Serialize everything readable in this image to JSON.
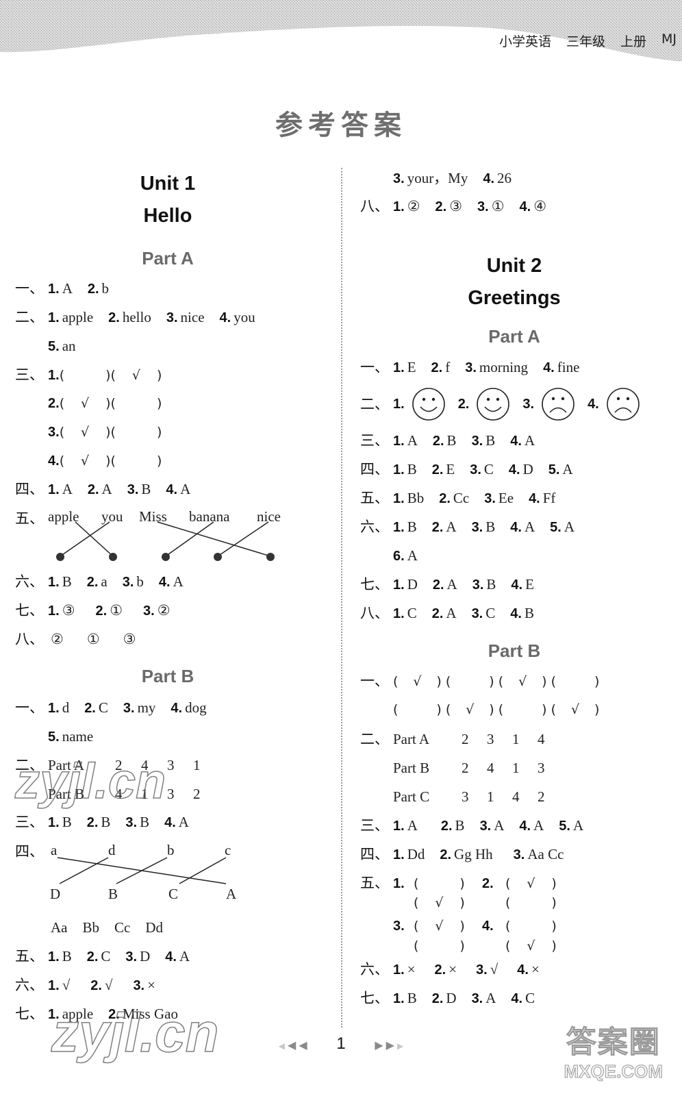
{
  "header": {
    "subject": "小学英语",
    "grade": "三年级",
    "volume": "上册",
    "edition": "MJ"
  },
  "page_title": "参考答案",
  "units": [
    {
      "unit": "Unit 1",
      "name": "Hello",
      "parts": [
        {
          "title": "Part A",
          "questions": {
            "q1": {
              "label": "一、",
              "items": [
                {
                  "n": "1.",
                  "a": "A"
                },
                {
                  "n": "2.",
                  "a": "b"
                }
              ]
            },
            "q2": {
              "label": "二、",
              "items": [
                {
                  "n": "1.",
                  "a": "apple"
                },
                {
                  "n": "2.",
                  "a": "hello"
                },
                {
                  "n": "3.",
                  "a": "nice"
                },
                {
                  "n": "4.",
                  "a": "you"
                },
                {
                  "n": "5.",
                  "a": "an"
                }
              ]
            },
            "q3": {
              "label": "三、",
              "rows": [
                {
                  "n": "1.",
                  "first": "",
                  "second": "√"
                },
                {
                  "n": "2.",
                  "first": "√",
                  "second": ""
                },
                {
                  "n": "3.",
                  "first": "√",
                  "second": ""
                },
                {
                  "n": "4.",
                  "first": "√",
                  "second": ""
                }
              ]
            },
            "q4": {
              "label": "四、",
              "items": [
                {
                  "n": "1.",
                  "a": "A"
                },
                {
                  "n": "2.",
                  "a": "A"
                },
                {
                  "n": "3.",
                  "a": "B"
                },
                {
                  "n": "4.",
                  "a": "A"
                }
              ]
            },
            "q5": {
              "label": "五、",
              "words": [
                "apple",
                "you",
                "Miss",
                "banana",
                "nice"
              ],
              "matches": [
                [
                  0,
                  1
                ],
                [
                  1,
                  0
                ],
                [
                  2,
                  4
                ],
                [
                  3,
                  2
                ],
                [
                  4,
                  3
                ]
              ]
            },
            "q6": {
              "label": "六、",
              "items": [
                {
                  "n": "1.",
                  "a": "B"
                },
                {
                  "n": "2.",
                  "a": "a"
                },
                {
                  "n": "3.",
                  "a": "b"
                },
                {
                  "n": "4.",
                  "a": "A"
                }
              ]
            },
            "q7": {
              "label": "七、",
              "items": [
                {
                  "n": "1.",
                  "a": "③"
                },
                {
                  "n": "2.",
                  "a": "①"
                },
                {
                  "n": "3.",
                  "a": "②"
                }
              ]
            },
            "q8": {
              "label": "八、",
              "items": [
                "②",
                "①",
                "③"
              ]
            }
          }
        },
        {
          "title": "Part B",
          "questions": {
            "q1": {
              "label": "一、",
              "items": [
                {
                  "n": "1.",
                  "a": "d"
                },
                {
                  "n": "2.",
                  "a": "C"
                },
                {
                  "n": "3.",
                  "a": "my"
                },
                {
                  "n": "4.",
                  "a": "dog"
                },
                {
                  "n": "5.",
                  "a": "name"
                }
              ]
            },
            "q2": {
              "label": "二、",
              "rows": [
                {
                  "part": "Part A",
                  "order": [
                    "2",
                    "4",
                    "3",
                    "1"
                  ]
                },
                {
                  "part": "Part B",
                  "order": [
                    "4",
                    "1",
                    "3",
                    "2"
                  ]
                }
              ]
            },
            "q3": {
              "label": "三、",
              "items": [
                {
                  "n": "1.",
                  "a": "B"
                },
                {
                  "n": "2.",
                  "a": "B"
                },
                {
                  "n": "3.",
                  "a": "B"
                },
                {
                  "n": "4.",
                  "a": "A"
                }
              ]
            },
            "q4": {
              "label": "四、",
              "top": [
                "a",
                "d",
                "b",
                "c"
              ],
              "bottom": [
                "D",
                "B",
                "C",
                "A"
              ],
              "pairs": [
                "Aa",
                "Bb",
                "Cc",
                "Dd"
              ]
            },
            "q5": {
              "label": "五、",
              "items": [
                {
                  "n": "1.",
                  "a": "B"
                },
                {
                  "n": "2.",
                  "a": "C"
                },
                {
                  "n": "3.",
                  "a": "D"
                },
                {
                  "n": "4.",
                  "a": "A"
                }
              ]
            },
            "q6": {
              "label": "六、",
              "items": [
                {
                  "n": "1.",
                  "a": "√"
                },
                {
                  "n": "2.",
                  "a": "√"
                },
                {
                  "n": "3.",
                  "a": "×"
                }
              ]
            },
            "q7": {
              "label": "七、",
              "items": [
                {
                  "n": "1.",
                  "a": "apple"
                },
                {
                  "n": "2.",
                  "a": "Miss Gao"
                },
                {
                  "n": "3.",
                  "a": "your，My"
                },
                {
                  "n": "4.",
                  "a": "26"
                }
              ]
            },
            "q8": {
              "label": "八、",
              "items": [
                {
                  "n": "1.",
                  "a": "②"
                },
                {
                  "n": "2.",
                  "a": "③"
                },
                {
                  "n": "3.",
                  "a": "①"
                },
                {
                  "n": "4.",
                  "a": "④"
                }
              ]
            }
          }
        }
      ]
    },
    {
      "unit": "Unit 2",
      "name": "Greetings",
      "parts": [
        {
          "title": "Part A",
          "questions": {
            "q1": {
              "label": "一、",
              "items": [
                {
                  "n": "1.",
                  "a": "E"
                },
                {
                  "n": "2.",
                  "a": "f"
                },
                {
                  "n": "3.",
                  "a": "morning"
                },
                {
                  "n": "4.",
                  "a": "fine"
                }
              ]
            },
            "q2": {
              "label": "二、",
              "items": [
                {
                  "n": "1.",
                  "a": "happy-face"
                },
                {
                  "n": "2.",
                  "a": "happy-face"
                },
                {
                  "n": "3.",
                  "a": "sad-face"
                },
                {
                  "n": "4.",
                  "a": "sad-face"
                }
              ]
            },
            "q3": {
              "label": "三、",
              "items": [
                {
                  "n": "1.",
                  "a": "A"
                },
                {
                  "n": "2.",
                  "a": "B"
                },
                {
                  "n": "3.",
                  "a": "B"
                },
                {
                  "n": "4.",
                  "a": "A"
                }
              ]
            },
            "q4": {
              "label": "四、",
              "items": [
                {
                  "n": "1.",
                  "a": "B"
                },
                {
                  "n": "2.",
                  "a": "E"
                },
                {
                  "n": "3.",
                  "a": "C"
                },
                {
                  "n": "4.",
                  "a": "D"
                },
                {
                  "n": "5.",
                  "a": "A"
                }
              ]
            },
            "q5": {
              "label": "五、",
              "items": [
                {
                  "n": "1.",
                  "a": "Bb"
                },
                {
                  "n": "2.",
                  "a": "Cc"
                },
                {
                  "n": "3.",
                  "a": "Ee"
                },
                {
                  "n": "4.",
                  "a": "Ff"
                }
              ]
            },
            "q6": {
              "label": "六、",
              "items": [
                {
                  "n": "1.",
                  "a": "B"
                },
                {
                  "n": "2.",
                  "a": "A"
                },
                {
                  "n": "3.",
                  "a": "B"
                },
                {
                  "n": "4.",
                  "a": "A"
                },
                {
                  "n": "5.",
                  "a": "A"
                },
                {
                  "n": "6.",
                  "a": "A"
                }
              ]
            },
            "q7": {
              "label": "七、",
              "items": [
                {
                  "n": "1.",
                  "a": "D"
                },
                {
                  "n": "2.",
                  "a": "A"
                },
                {
                  "n": "3.",
                  "a": "B"
                },
                {
                  "n": "4.",
                  "a": "E"
                }
              ]
            },
            "q8": {
              "label": "八、",
              "items": [
                {
                  "n": "1.",
                  "a": "C"
                },
                {
                  "n": "2.",
                  "a": "A"
                },
                {
                  "n": "3.",
                  "a": "C"
                },
                {
                  "n": "4.",
                  "a": "B"
                }
              ]
            }
          }
        },
        {
          "title": "Part B",
          "questions": {
            "q1": {
              "label": "一、",
              "rows": [
                [
                  "√",
                  "",
                  "√",
                  ""
                ],
                [
                  "",
                  "√",
                  "",
                  "√"
                ]
              ]
            },
            "q2": {
              "label": "二、",
              "rows": [
                {
                  "part": "Part A",
                  "order": [
                    "2",
                    "3",
                    "1",
                    "4"
                  ]
                },
                {
                  "part": "Part B",
                  "order": [
                    "2",
                    "4",
                    "1",
                    "3"
                  ]
                },
                {
                  "part": "Part C",
                  "order": [
                    "3",
                    "1",
                    "4",
                    "2"
                  ]
                }
              ]
            },
            "q3": {
              "label": "三、",
              "items": [
                {
                  "n": "1.",
                  "a": "A"
                },
                {
                  "n": "2.",
                  "a": "B"
                },
                {
                  "n": "3.",
                  "a": "A"
                },
                {
                  "n": "4.",
                  "a": "A"
                },
                {
                  "n": "5.",
                  "a": "A"
                }
              ]
            },
            "q4": {
              "label": "四、",
              "items": [
                {
                  "n": "1.",
                  "a": "Dd"
                },
                {
                  "n": "2.",
                  "a": "Gg Hh"
                },
                {
                  "n": "3.",
                  "a": "Aa Cc"
                }
              ]
            },
            "q5": {
              "label": "五、",
              "items": [
                {
                  "n": "1.",
                  "top": "",
                  "bottom": "√"
                },
                {
                  "n": "2.",
                  "top": "√",
                  "bottom": ""
                },
                {
                  "n": "3.",
                  "top": "√",
                  "bottom": ""
                },
                {
                  "n": "4.",
                  "top": "",
                  "bottom": "√"
                }
              ]
            },
            "q6": {
              "label": "六、",
              "items": [
                {
                  "n": "1.",
                  "a": "×"
                },
                {
                  "n": "2.",
                  "a": "×"
                },
                {
                  "n": "3.",
                  "a": "√"
                },
                {
                  "n": "4.",
                  "a": "×"
                }
              ]
            },
            "q7": {
              "label": "七、",
              "items": [
                {
                  "n": "1.",
                  "a": "B"
                },
                {
                  "n": "2.",
                  "a": "D"
                },
                {
                  "n": "3.",
                  "a": "A"
                },
                {
                  "n": "4.",
                  "a": "C"
                }
              ]
            }
          }
        }
      ]
    }
  ],
  "pager": {
    "page_number": "1",
    "prev_icon": "◀",
    "next_icon": "▶"
  },
  "watermarks": {
    "left": "zyjl.cn",
    "right_top": "答案圈",
    "right_bottom": "MXQE.COM"
  }
}
